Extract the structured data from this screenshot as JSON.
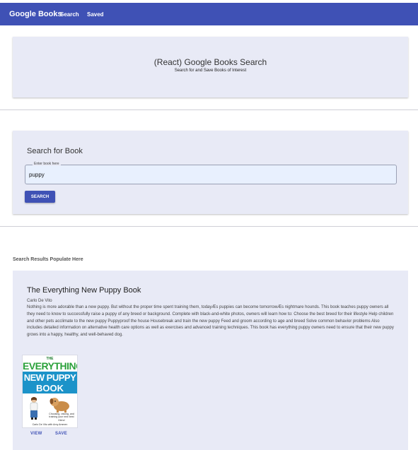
{
  "navbar": {
    "brand": "Google Books",
    "links": [
      "Search",
      "Saved"
    ],
    "color": "#3f51b5"
  },
  "jumbotron": {
    "title": "(React) Google Books Search",
    "subtitle": "Search for and Save Books of Interest"
  },
  "search": {
    "heading": "Search for Book",
    "field_label": "Enter book here",
    "value": "puppy",
    "button_label": "SEARCH"
  },
  "results": {
    "heading": "Search Results Populate Here",
    "books": [
      {
        "title": "The Everything New Puppy Book",
        "author": "Carlo De Vito",
        "description": "Nothing is more adorable than a new puppy. But without the proper time spent training them, todayÆs puppies can become tomorrowÆs nightmare hounds. This book teaches puppy owners all they need to know to successfully raise a puppy of any breed or background. Complete with black-and-white photos, owners will learn how to: Choose the best breed for their lifestyle Help children and other pets acclimate to the new puppy Puppyproof the house Housebreak and train the new puppy Feed and groom according to age and breed Solve common behavior problems Also includes detailed information on alternative health care options as well as exercises and advanced training techniques. This book has everything puppy owners need to ensure that their new puppy grows into a happy, healthy, and well-behaved dog.",
        "cover": {
          "line1": "THE",
          "line2": "EVERYTHING",
          "line3": "NEW PUPPY",
          "line4": "BOOK",
          "tagline": "Choosing, raising, and training your new best friend",
          "authors": "Carlo De Vito with Amy Ammen"
        },
        "view_label": "VIEW",
        "save_label": "SAVE"
      }
    ]
  }
}
